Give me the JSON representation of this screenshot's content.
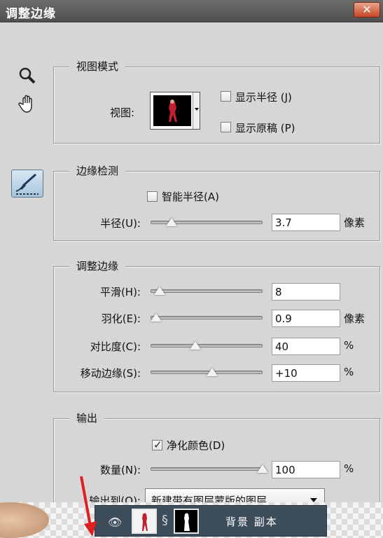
{
  "window": {
    "title": "调整边缘",
    "close_label": "✕"
  },
  "tools": [
    "zoom-icon",
    "hand-icon",
    "refine-brush-icon"
  ],
  "view_mode": {
    "legend": "视图模式",
    "view_label": "视图:",
    "show_radius": {
      "label": "显示半径 (J)",
      "checked": false
    },
    "show_original": {
      "label": "显示原稿 (P)",
      "checked": false
    }
  },
  "edge_detection": {
    "legend": "边缘检测",
    "smart_radius": {
      "label": "智能半径(A)",
      "checked": false
    },
    "radius": {
      "label": "半径(U):",
      "value": "3.7",
      "unit": "像素",
      "level": 0.2
    }
  },
  "adjust_edge": {
    "legend": "调整边缘",
    "rows": [
      {
        "label": "平滑(H):",
        "value": "8",
        "unit": "",
        "level": 0.1
      },
      {
        "label": "羽化(E):",
        "value": "0.9",
        "unit": "像素",
        "level": 0.02
      },
      {
        "label": "对比度(C):",
        "value": "40",
        "unit": "%",
        "level": 0.4
      },
      {
        "label": "移动边缘(S):",
        "value": "+10",
        "unit": "%",
        "level": 0.55
      }
    ]
  },
  "output": {
    "legend": "输出",
    "decontaminate": {
      "label": "净化颜色(D)",
      "checked": true
    },
    "amount": {
      "label": "数量(N):",
      "value": "100",
      "unit": "%",
      "level": 1.0
    },
    "output_to": {
      "label": "输出到(O):",
      "value": "新建带有图层蒙版的图层"
    }
  },
  "layers": {
    "layer_name": "背景 副本"
  }
}
